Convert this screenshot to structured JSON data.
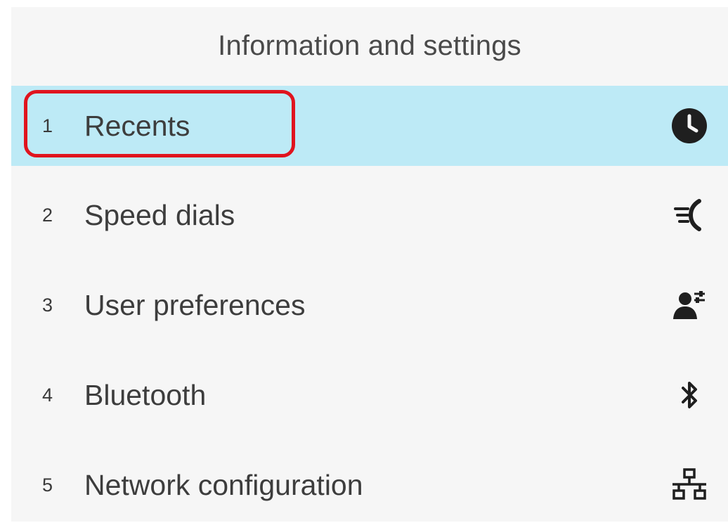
{
  "header": {
    "title": "Information and settings"
  },
  "menu": {
    "items": [
      {
        "number": "1",
        "label": "Recents",
        "icon": "clock-icon",
        "selected": true
      },
      {
        "number": "2",
        "label": "Speed dials",
        "icon": "speed-dial-icon",
        "selected": false
      },
      {
        "number": "3",
        "label": "User preferences",
        "icon": "user-preferences-icon",
        "selected": false
      },
      {
        "number": "4",
        "label": "Bluetooth",
        "icon": "bluetooth-icon",
        "selected": false
      },
      {
        "number": "5",
        "label": "Network configuration",
        "icon": "network-icon",
        "selected": false
      }
    ]
  },
  "colors": {
    "background": "#f6f6f6",
    "selected_row": "#bdeaf6",
    "highlight_border": "#e0141e",
    "text": "#3d3d3d"
  }
}
